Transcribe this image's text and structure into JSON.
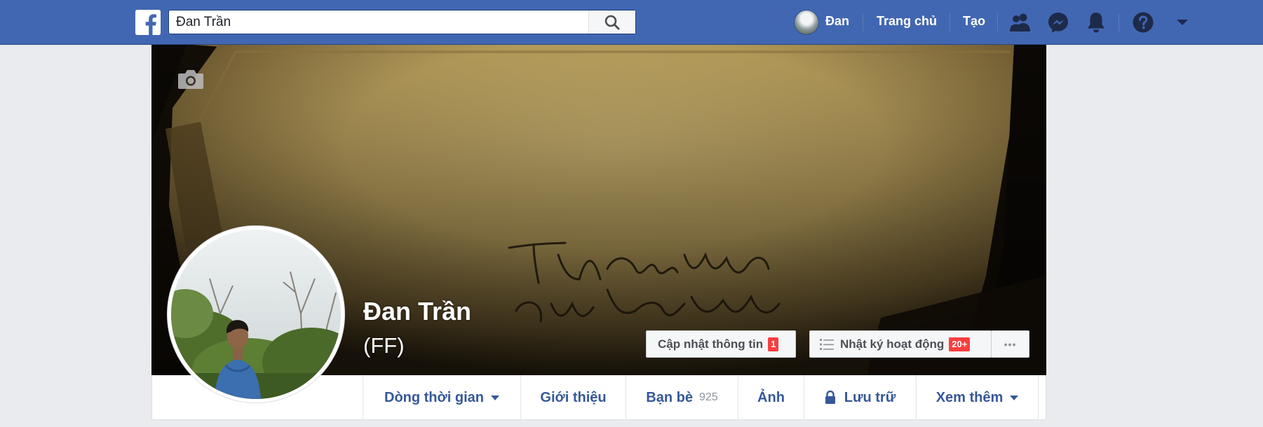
{
  "search": {
    "value": "Đan Trần"
  },
  "topnav": {
    "user_name": "Đan",
    "home_label": "Trang chủ",
    "create_label": "Tạo"
  },
  "profile": {
    "name": "Đan Trần",
    "alternate_name": "(FF)"
  },
  "cover": {
    "update_info_label": "Cập nhật thông tin",
    "update_info_badge": "1",
    "activity_log_label": "Nhật ký hoạt động",
    "activity_log_badge": "20+",
    "more_label": "•••"
  },
  "tabs": {
    "timeline": "Dòng thời gian",
    "about": "Giới thiệu",
    "friends": "Bạn bè",
    "friends_count": "925",
    "photos": "Ảnh",
    "archive": "Lưu trữ",
    "more": "Xem thêm"
  },
  "colors": {
    "brand": "#4267b2",
    "link": "#365899",
    "badge": "#fa3e3e"
  }
}
